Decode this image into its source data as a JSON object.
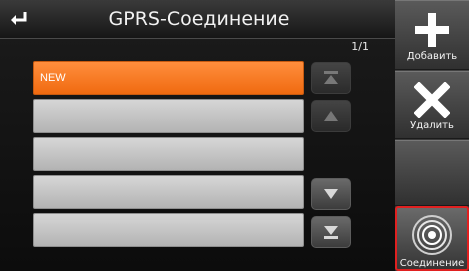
{
  "header": {
    "title": "GPRS-Соединение",
    "back_icon": "back-arrow-icon",
    "page_indicator": "1/1"
  },
  "list": {
    "rows": [
      {
        "label": "NEW",
        "selected": true
      },
      {
        "label": "",
        "selected": false
      },
      {
        "label": "",
        "selected": false
      },
      {
        "label": "",
        "selected": false
      },
      {
        "label": "",
        "selected": false
      }
    ]
  },
  "scroll": {
    "top_icon": "scroll-to-top-icon",
    "up_icon": "scroll-up-icon",
    "down_icon": "scroll-down-icon",
    "bottom_icon": "scroll-to-bottom-icon"
  },
  "sidebar": {
    "add_label": "Добавить",
    "delete_label": "Удалить",
    "connect_label": "Соединение"
  },
  "colors": {
    "selected_row": "#f47a1f",
    "row": "#c4c4c4",
    "highlight_border": "#e02020"
  }
}
